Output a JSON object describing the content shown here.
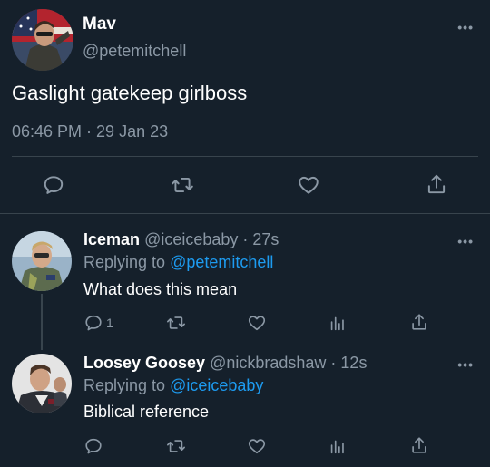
{
  "main_tweet": {
    "display_name": "Mav",
    "handle": "@petemitchell",
    "text": "Gaslight gatekeep girlboss",
    "timestamp": "06:46 PM · 29 Jan 23",
    "actions": [
      "reply-icon",
      "retweet-icon",
      "like-icon",
      "share-icon"
    ]
  },
  "replies": [
    {
      "display_name": "Iceman",
      "handle": "@iceicebaby",
      "age": "· 27s",
      "replying_label": "Replying to",
      "replying_to": "@petemitchell",
      "text": "What does this mean",
      "reply_count": "1",
      "actions": [
        "reply-icon",
        "retweet-icon",
        "like-icon",
        "analytics-icon",
        "share-icon"
      ]
    },
    {
      "display_name": "Loosey Goosey",
      "handle": "@nickbradshaw",
      "age": "· 12s",
      "replying_label": "Replying to",
      "replying_to": "@iceicebaby",
      "text": "Biblical reference",
      "reply_count": "",
      "actions": [
        "reply-icon",
        "retweet-icon",
        "like-icon",
        "analytics-icon",
        "share-icon"
      ]
    }
  ],
  "more_label": "•••",
  "colors": {
    "background": "#15202b",
    "secondary_text": "#8b98a5",
    "link": "#1d9bf0",
    "divider": "#38444d"
  }
}
